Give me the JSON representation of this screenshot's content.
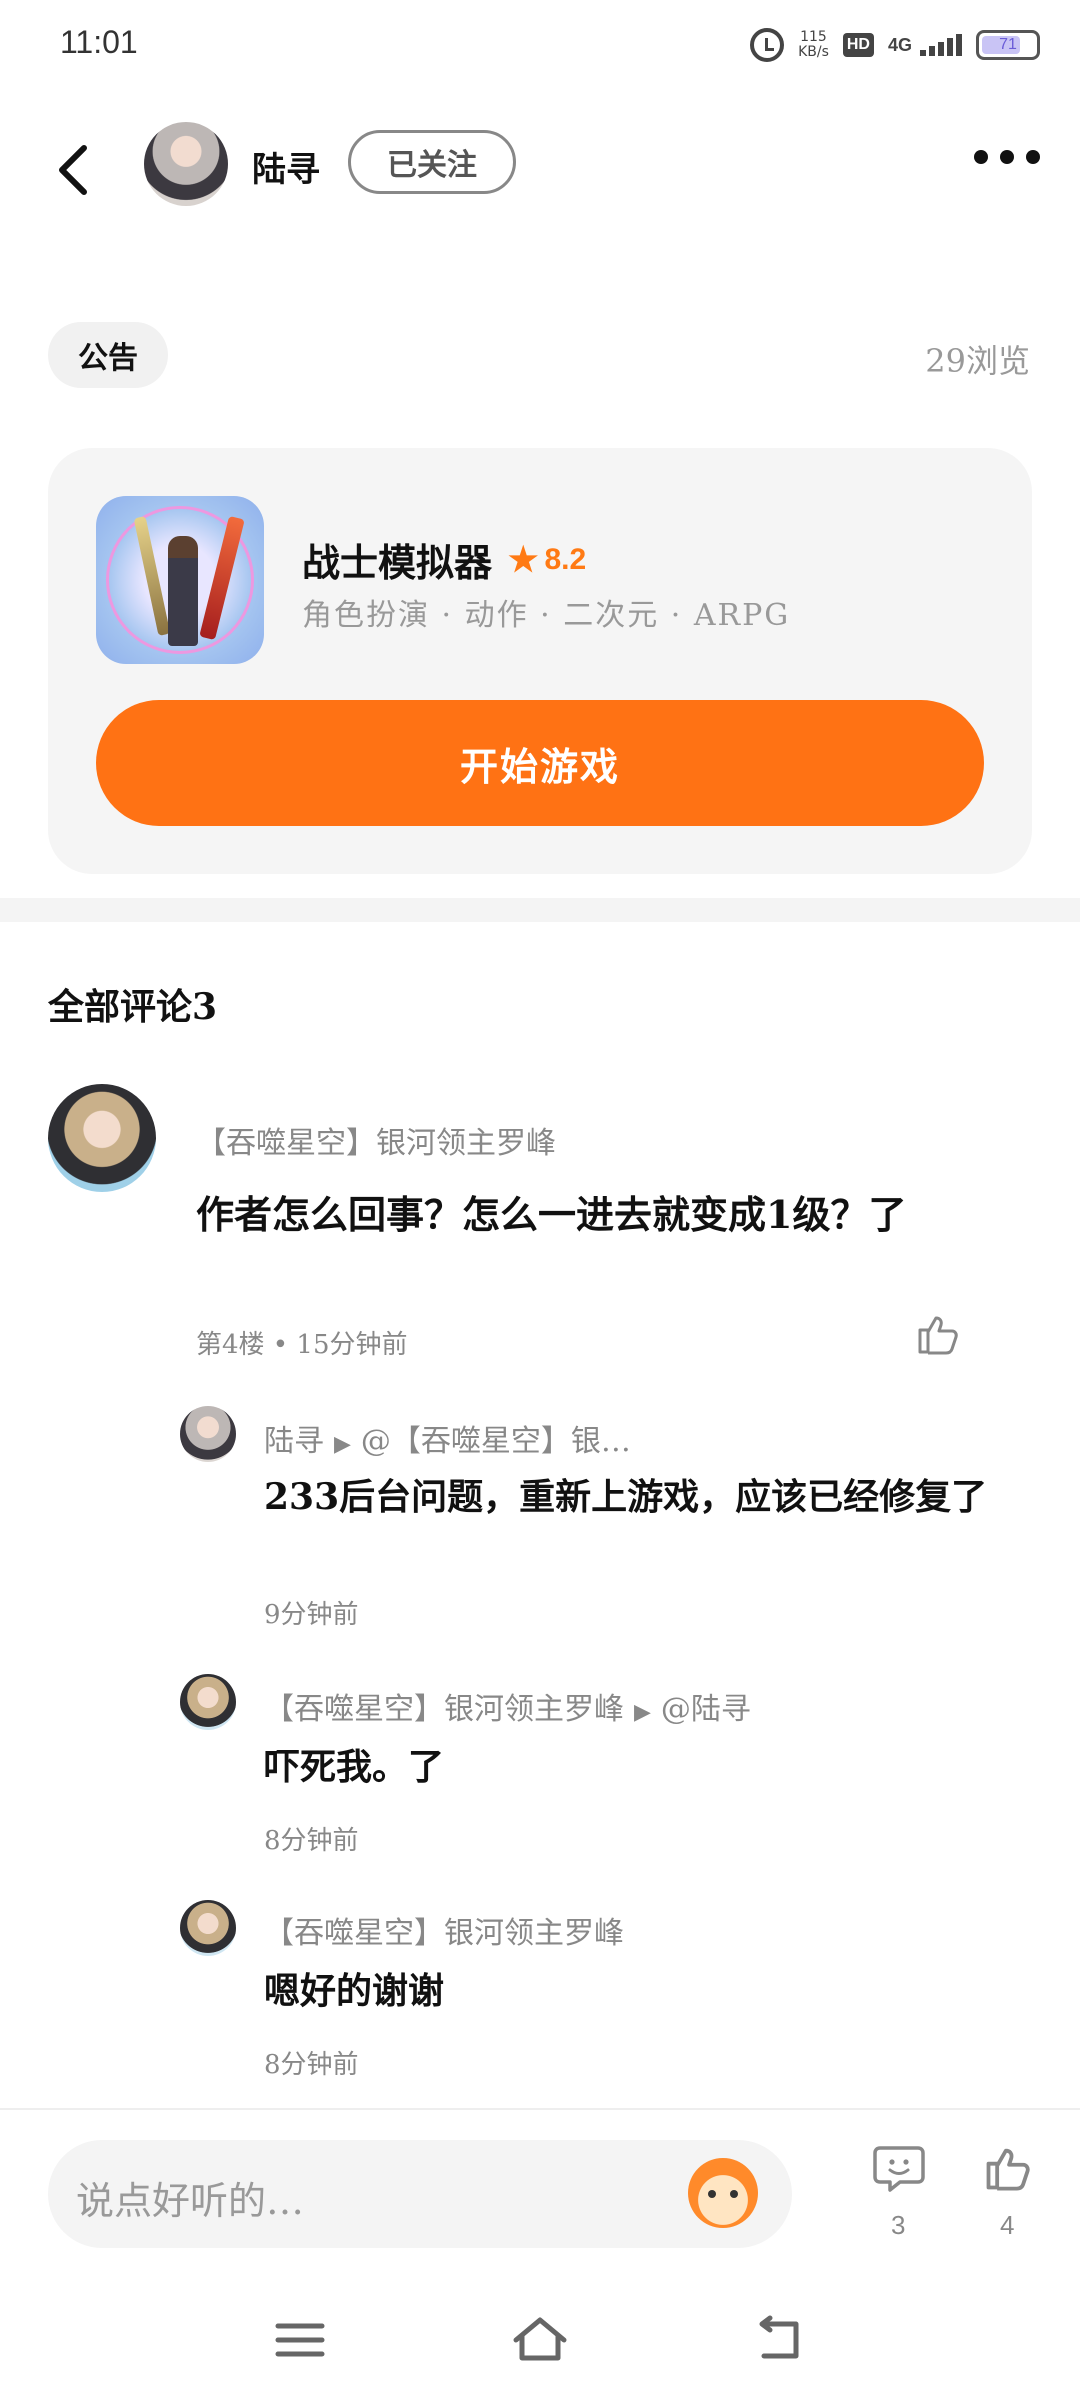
{
  "status_bar": {
    "time": "11:01",
    "net_speed_value": "115",
    "net_speed_unit": "KB/s",
    "hd_badge": "HD",
    "network": "4G",
    "battery": "71"
  },
  "header": {
    "author_name": "陆寻",
    "follow_label": "已关注"
  },
  "post": {
    "tag": "公告",
    "views": "29浏览"
  },
  "game": {
    "name": "战士模拟器",
    "rating": "8.2",
    "tags": "角色扮演 · 动作 · 二次元 · ARPG",
    "start_label": "开始游戏"
  },
  "comments": {
    "title": "全部评论3",
    "main": {
      "user": "【吞噬星空】银河领主罗峰",
      "text": "作者怎么回事？怎么一进去就变成1级？了",
      "meta": "第4楼 • 15分钟前"
    },
    "replies": [
      {
        "user": "陆寻",
        "to": "@【吞噬星空】银…",
        "text": "233后台问题，重新上游戏，应该已经修复了",
        "time": "9分钟前"
      },
      {
        "user": "【吞噬星空】银河领主罗峰",
        "to": "@陆寻",
        "text": "吓死我。了",
        "time": "8分钟前"
      },
      {
        "user": "【吞噬星空】银河领主罗峰",
        "to": "",
        "text": "嗯好的谢谢",
        "time": "8分钟前"
      }
    ]
  },
  "bottom_bar": {
    "placeholder": "说点好听的…",
    "comment_count": "3",
    "like_count": "4"
  },
  "colors": {
    "accent": "#ff7214",
    "star": "#ff7a14"
  },
  "icons": [
    "back-icon",
    "more-icon",
    "star-icon",
    "like-icon",
    "emoji-icon",
    "comment-icon",
    "menu-icon",
    "home-icon",
    "back-nav-icon"
  ]
}
